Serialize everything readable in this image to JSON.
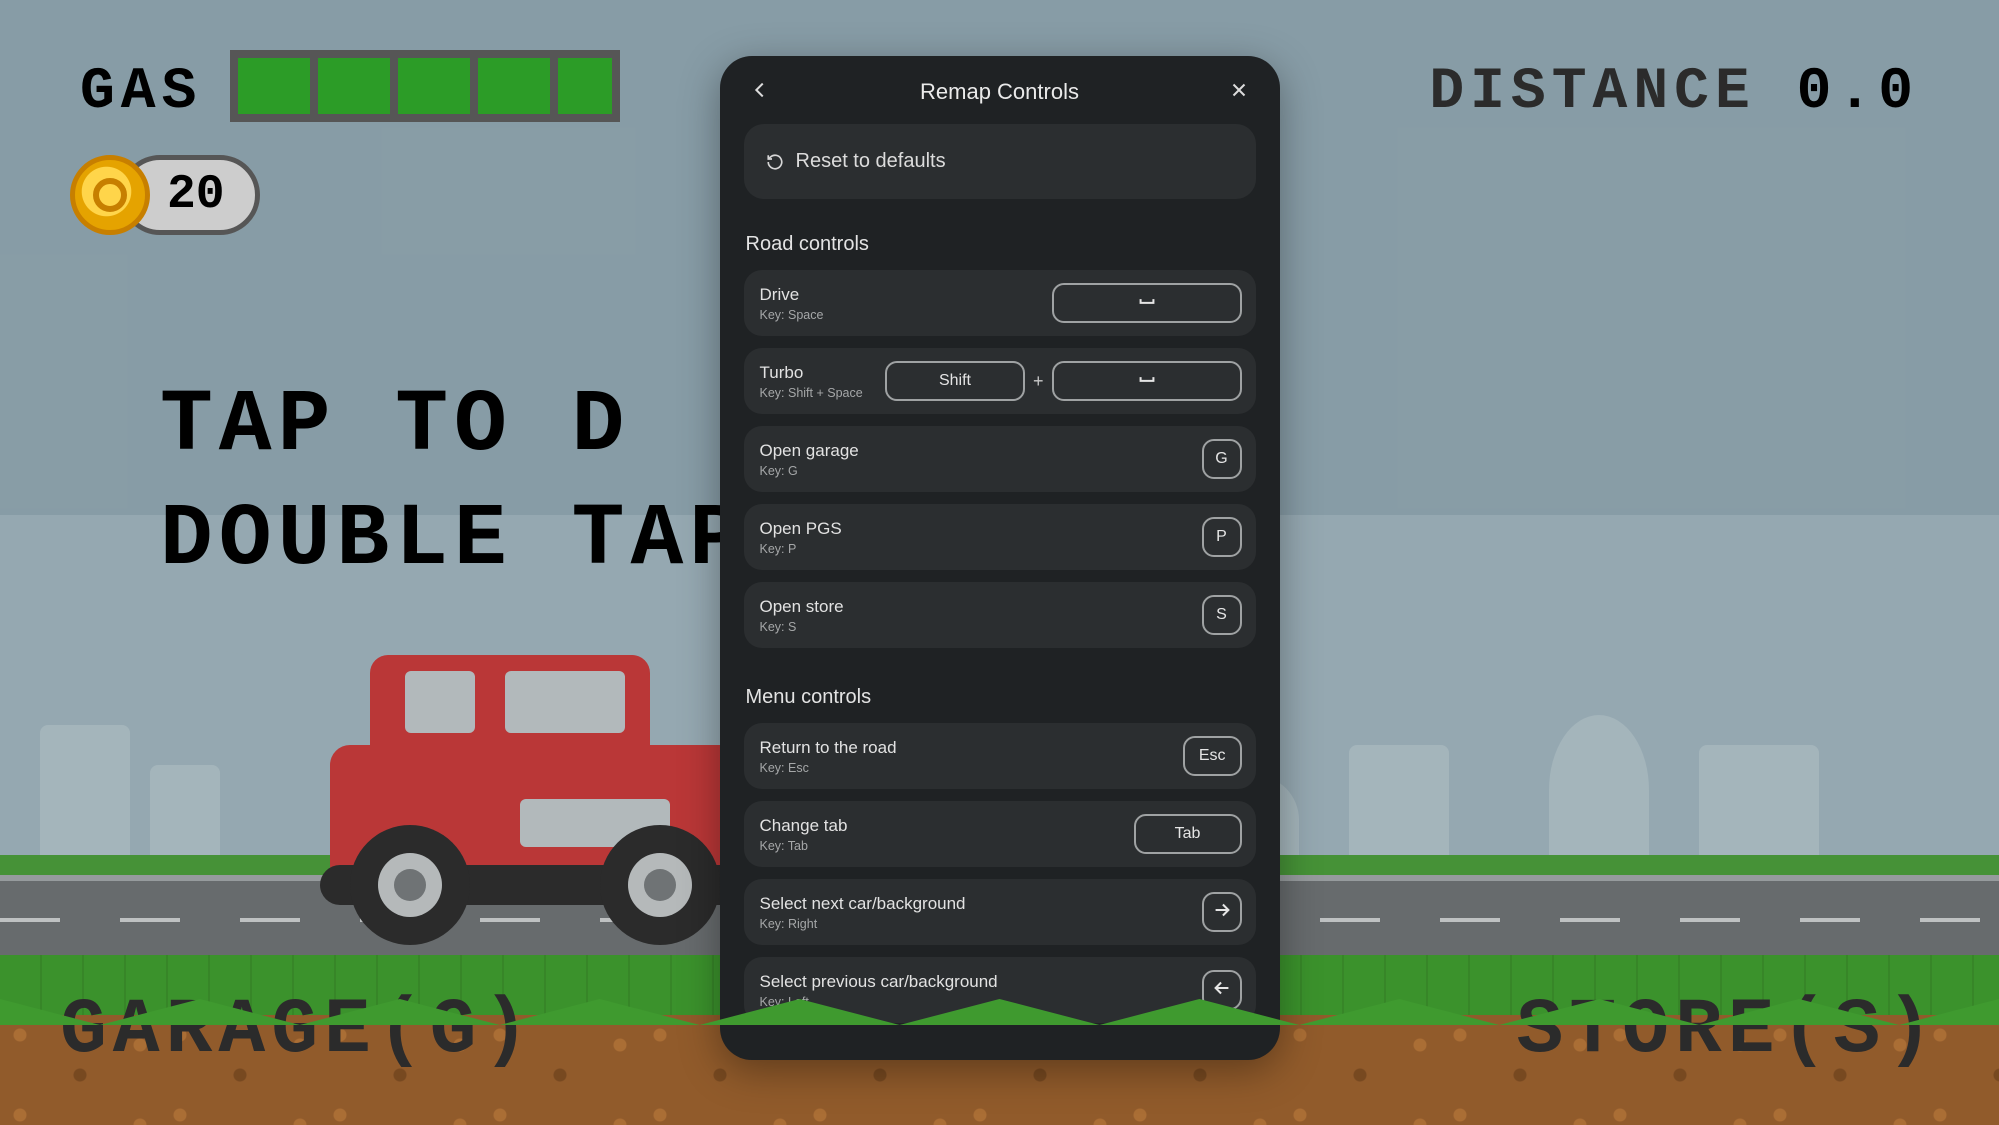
{
  "hud": {
    "gas_label": "GAS",
    "coins": "20",
    "distance_label": "DISTANCE",
    "distance_value": "0.0",
    "center_line1": "TAP TO D",
    "center_line2": "DOUBLE TAP",
    "garage_label": "GARAGE(G)",
    "store_label": "STORE(S)"
  },
  "modal": {
    "title": "Remap Controls",
    "reset_label": "Reset to defaults",
    "key_prefix": "Key: ",
    "plus": "+",
    "sections": {
      "road": {
        "title": "Road controls",
        "drive": {
          "label": "Drive",
          "sub": "Key: Space"
        },
        "turbo": {
          "label": "Turbo",
          "sub": "Key: Shift + Space",
          "shift_key": "Shift"
        },
        "garage": {
          "label": "Open garage",
          "sub": "Key: G",
          "key": "G"
        },
        "pgs": {
          "label": "Open PGS",
          "sub": "Key: P",
          "key": "P"
        },
        "store": {
          "label": "Open store",
          "sub": "Key: S",
          "key": "S"
        }
      },
      "menu": {
        "title": "Menu controls",
        "return": {
          "label": "Return to the road",
          "sub": "Key: Esc",
          "key": "Esc"
        },
        "change_tab": {
          "label": "Change tab",
          "sub": "Key: Tab",
          "key": "Tab"
        },
        "next": {
          "label": "Select next car/background",
          "sub": "Key: Right"
        },
        "prev": {
          "label": "Select previous car/background",
          "sub": "Key: Left"
        }
      }
    }
  }
}
